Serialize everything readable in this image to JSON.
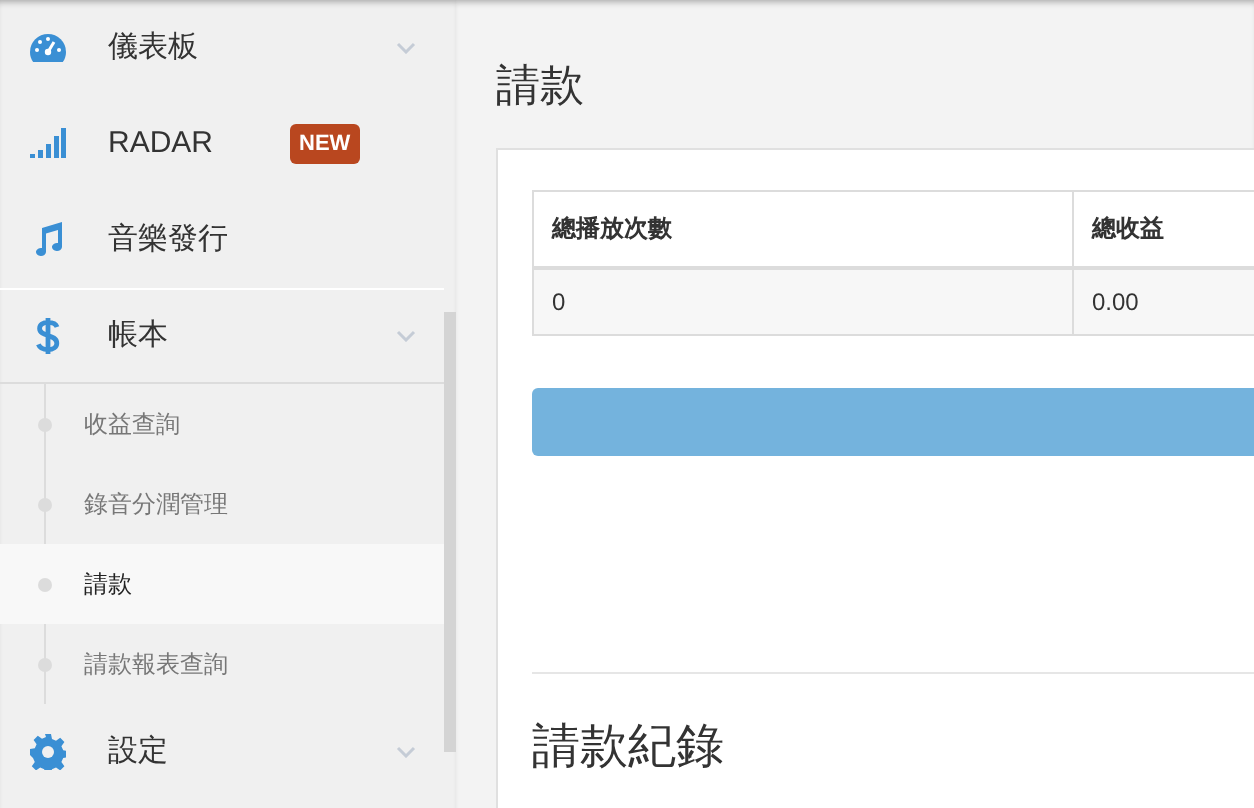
{
  "sidebar": {
    "items": [
      {
        "kind": "gauge",
        "label": "儀表板",
        "expandable": true
      },
      {
        "kind": "signal",
        "label": "RADAR",
        "badge": "NEW"
      },
      {
        "kind": "music",
        "label": "音樂發行"
      },
      {
        "kind": "dollar",
        "label": "帳本",
        "expandable": true,
        "children": [
          {
            "label": "收益查詢",
            "selected": false
          },
          {
            "label": "錄音分潤管理",
            "selected": false
          },
          {
            "label": "請款",
            "selected": true
          },
          {
            "label": "請款報表查詢",
            "selected": false
          }
        ]
      },
      {
        "kind": "gear",
        "label": "設定",
        "expandable": true
      }
    ]
  },
  "page": {
    "title": "請款",
    "table": {
      "columns": [
        "總播放次數",
        "總收益"
      ],
      "rows": [
        [
          "0",
          "0.00"
        ]
      ]
    },
    "section_title": "請款紀錄"
  }
}
